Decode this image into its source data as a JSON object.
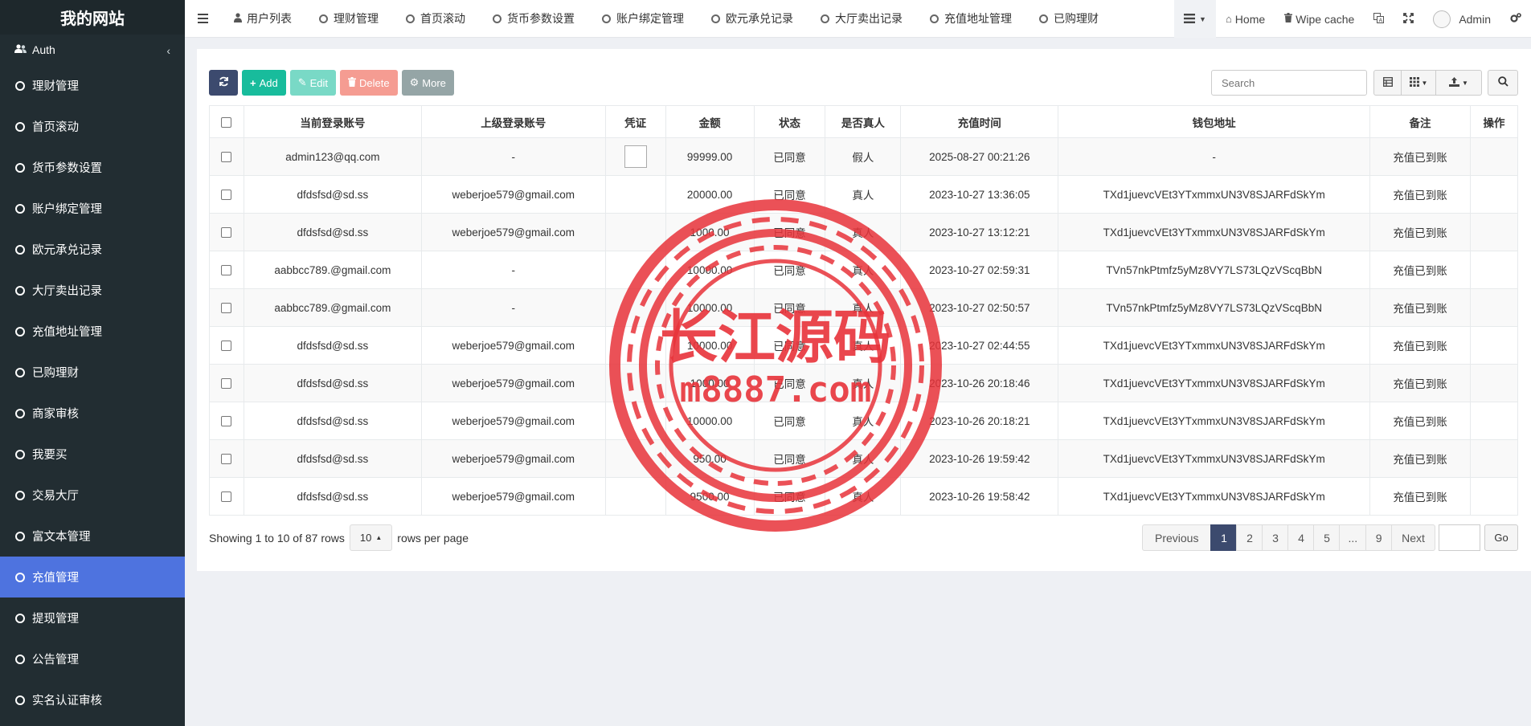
{
  "brand": "我的网站",
  "sidebar": {
    "auth_label": "Auth",
    "items": [
      {
        "label": "理财管理",
        "active": false
      },
      {
        "label": "首页滚动",
        "active": false
      },
      {
        "label": "货币参数设置",
        "active": false
      },
      {
        "label": "账户绑定管理",
        "active": false
      },
      {
        "label": "欧元承兑记录",
        "active": false
      },
      {
        "label": "大厅卖出记录",
        "active": false
      },
      {
        "label": "充值地址管理",
        "active": false
      },
      {
        "label": "已购理财",
        "active": false
      },
      {
        "label": "商家审核",
        "active": false
      },
      {
        "label": "我要买",
        "active": false
      },
      {
        "label": "交易大厅",
        "active": false
      },
      {
        "label": "富文本管理",
        "active": false
      },
      {
        "label": "充值管理",
        "active": true
      },
      {
        "label": "提现管理",
        "active": false
      },
      {
        "label": "公告管理",
        "active": false
      },
      {
        "label": "实名认证审核",
        "active": false
      }
    ]
  },
  "navbar": {
    "tabs": [
      "用户列表",
      "理财管理",
      "首页滚动",
      "货币参数设置",
      "账户绑定管理",
      "欧元承兑记录",
      "大厅卖出记录",
      "充值地址管理",
      "已购理财"
    ],
    "home": "Home",
    "wipe_cache": "Wipe cache",
    "admin": "Admin"
  },
  "toolbar": {
    "add": "Add",
    "edit": "Edit",
    "delete": "Delete",
    "more": "More",
    "search_placeholder": "Search"
  },
  "table": {
    "headers": [
      "当前登录账号",
      "上级登录账号",
      "凭证",
      "金额",
      "状态",
      "是否真人",
      "充值时间",
      "钱包地址",
      "备注",
      "操作"
    ],
    "rows": [
      {
        "account": "admin123@qq.com",
        "parent": "-",
        "proof": true,
        "amount": "99999.00",
        "status": "已同意",
        "real": "假人",
        "time": "2025-08-27 00:21:26",
        "wallet": "-",
        "remark": "充值已到账"
      },
      {
        "account": "dfdsfsd@sd.ss",
        "parent": "weberjoe579@gmail.com",
        "proof": false,
        "amount": "20000.00",
        "status": "已同意",
        "real": "真人",
        "time": "2023-10-27 13:36:05",
        "wallet": "TXd1juevcVEt3YTxmmxUN3V8SJARFdSkYm",
        "remark": "充值已到账"
      },
      {
        "account": "dfdsfsd@sd.ss",
        "parent": "weberjoe579@gmail.com",
        "proof": false,
        "amount": "1000.00",
        "status": "已同意",
        "real": "真人",
        "time": "2023-10-27 13:12:21",
        "wallet": "TXd1juevcVEt3YTxmmxUN3V8SJARFdSkYm",
        "remark": "充值已到账"
      },
      {
        "account": "aabbcc789.@gmail.com",
        "parent": "-",
        "proof": false,
        "amount": "10000.00",
        "status": "已同意",
        "real": "真人",
        "time": "2023-10-27 02:59:31",
        "wallet": "TVn57nkPtmfz5yMz8VY7LS73LQzVScqBbN",
        "remark": "充值已到账"
      },
      {
        "account": "aabbcc789.@gmail.com",
        "parent": "-",
        "proof": false,
        "amount": "10000.00",
        "status": "已同意",
        "real": "真人",
        "time": "2023-10-27 02:50:57",
        "wallet": "TVn57nkPtmfz5yMz8VY7LS73LQzVScqBbN",
        "remark": "充值已到账"
      },
      {
        "account": "dfdsfsd@sd.ss",
        "parent": "weberjoe579@gmail.com",
        "proof": false,
        "amount": "10000.00",
        "status": "已同意",
        "real": "真人",
        "time": "2023-10-27 02:44:55",
        "wallet": "TXd1juevcVEt3YTxmmxUN3V8SJARFdSkYm",
        "remark": "充值已到账"
      },
      {
        "account": "dfdsfsd@sd.ss",
        "parent": "weberjoe579@gmail.com",
        "proof": false,
        "amount": "1000.00",
        "status": "已同意",
        "real": "真人",
        "time": "2023-10-26 20:18:46",
        "wallet": "TXd1juevcVEt3YTxmmxUN3V8SJARFdSkYm",
        "remark": "充值已到账"
      },
      {
        "account": "dfdsfsd@sd.ss",
        "parent": "weberjoe579@gmail.com",
        "proof": false,
        "amount": "10000.00",
        "status": "已同意",
        "real": "真人",
        "time": "2023-10-26 20:18:21",
        "wallet": "TXd1juevcVEt3YTxmmxUN3V8SJARFdSkYm",
        "remark": "充值已到账"
      },
      {
        "account": "dfdsfsd@sd.ss",
        "parent": "weberjoe579@gmail.com",
        "proof": false,
        "amount": "950.00",
        "status": "已同意",
        "real": "真人",
        "time": "2023-10-26 19:59:42",
        "wallet": "TXd1juevcVEt3YTxmmxUN3V8SJARFdSkYm",
        "remark": "充值已到账"
      },
      {
        "account": "dfdsfsd@sd.ss",
        "parent": "weberjoe579@gmail.com",
        "proof": false,
        "amount": "9500.00",
        "status": "已同意",
        "real": "真人",
        "time": "2023-10-26 19:58:42",
        "wallet": "TXd1juevcVEt3YTxmmxUN3V8SJARFdSkYm",
        "remark": "充值已到账"
      }
    ]
  },
  "footer": {
    "showing": "Showing 1 to 10 of 87 rows",
    "page_size": "10",
    "rows_per_page": "rows per page"
  },
  "pagination": {
    "previous": "Previous",
    "pages": [
      "1",
      "2",
      "3",
      "4",
      "5",
      "...",
      "9"
    ],
    "active_page": "1",
    "next": "Next",
    "go": "Go"
  },
  "watermark": {
    "title": "长江源码",
    "url": "m8887.com",
    "color": "#e8333a"
  },
  "colors": {
    "sidebar_bg": "#222d32",
    "active_item": "#4e73df",
    "success": "#18bc9c",
    "primary": "#3c4a6e"
  }
}
